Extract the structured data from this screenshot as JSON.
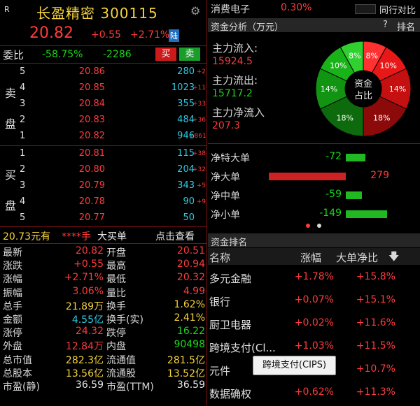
{
  "header": {
    "tag": "R",
    "stock_name": "长盈精密",
    "stock_code": "300115",
    "price": "20.82",
    "change": "+0.55",
    "change_pct": "+2.71%",
    "board_badge": "陆"
  },
  "committee": {
    "label": "委比",
    "ratio": "-58.75%",
    "diff": "-2286",
    "buy_label": "买",
    "sell_label": "卖"
  },
  "order_book": {
    "sell_side_label": "卖盘",
    "buy_side_label": "买盘",
    "sell": [
      {
        "level": "5",
        "price": "20.86",
        "volume": "280",
        "delta": "+2"
      },
      {
        "level": "4",
        "price": "20.85",
        "volume": "1023",
        "delta": "+11"
      },
      {
        "level": "3",
        "price": "20.84",
        "volume": "355",
        "delta": "+33"
      },
      {
        "level": "2",
        "price": "20.83",
        "volume": "484",
        "delta": "+36"
      },
      {
        "level": "1",
        "price": "20.82",
        "volume": "946",
        "delta": "+861"
      }
    ],
    "buy": [
      {
        "level": "1",
        "price": "20.81",
        "volume": "115",
        "delta": "+38"
      },
      {
        "level": "2",
        "price": "20.80",
        "volume": "204",
        "delta": "+32"
      },
      {
        "level": "3",
        "price": "20.79",
        "volume": "343",
        "delta": "+5"
      },
      {
        "level": "4",
        "price": "20.78",
        "volume": "90",
        "delta": "+9"
      },
      {
        "level": "5",
        "price": "20.77",
        "volume": "50",
        "delta": ""
      }
    ]
  },
  "big_order_bar": {
    "price_text": "20.73元有",
    "qty_text": "****手",
    "label": "大买单",
    "link": "点击查看"
  },
  "stats": [
    {
      "l1": "最新",
      "v1": "20.82",
      "c1": "red",
      "l2": "开盘",
      "v2": "20.51",
      "c2": "red"
    },
    {
      "l1": "涨跌",
      "v1": "+0.55",
      "c1": "red",
      "l2": "最高",
      "v2": "20.94",
      "c2": "red"
    },
    {
      "l1": "涨幅",
      "v1": "+2.71%",
      "c1": "red",
      "l2": "最低",
      "v2": "20.32",
      "c2": "red"
    },
    {
      "l1": "振幅",
      "v1": "3.06%",
      "c1": "red",
      "l2": "量比",
      "v2": "4.99",
      "c2": "red"
    },
    {
      "l1": "总手",
      "v1": "21.89万",
      "c1": "yellow",
      "l2": "换手",
      "v2": "1.62%",
      "c2": "yellow"
    },
    {
      "l1": "金额",
      "v1": "4.55亿",
      "c1": "cyan",
      "l2": "换手(实)",
      "v2": "2.41%",
      "c2": "yellow"
    },
    {
      "l1": "涨停",
      "v1": "24.32",
      "c1": "red",
      "l2": "跌停",
      "v2": "16.22",
      "c2": "green"
    },
    {
      "l1": "外盘",
      "v1": "12.84万",
      "c1": "red",
      "l2": "内盘",
      "v2": "90498",
      "c2": "green"
    },
    {
      "l1": "总市值",
      "v1": "282.3亿",
      "c1": "yellow",
      "l2": "流通值",
      "v2": "281.5亿",
      "c2": "yellow"
    },
    {
      "l1": "总股本",
      "v1": "13.56亿",
      "c1": "yellow",
      "l2": "流通股",
      "v2": "13.52亿",
      "c2": "yellow"
    },
    {
      "l1": "市盈(静)",
      "v1": "36.59",
      "c1": "white",
      "l2": "市盈(TTM)",
      "v2": "36.59",
      "c2": "white"
    }
  ],
  "sector_top": {
    "name": "消费电子",
    "pct": "0.30%",
    "compare": "同行对比"
  },
  "fund_analysis": {
    "title": "资金分析（万元）",
    "help": "?",
    "rank_link": "排名",
    "inflow_label": "主力流入:",
    "inflow_value": "15924.5",
    "outflow_label": "主力流出:",
    "outflow_value": "15717.2",
    "net_label": "主力净流入",
    "net_value": "207.3",
    "donut_center_1": "资金",
    "donut_center_2": "占比",
    "donut": [
      {
        "label": "8%",
        "value": 8,
        "color": "#ff3131"
      },
      {
        "label": "10%",
        "value": 10,
        "color": "#e81818"
      },
      {
        "label": "14%",
        "value": 14,
        "color": "#c41010"
      },
      {
        "label": "18%",
        "value": 18,
        "color": "#8c0a0a"
      },
      {
        "label": "18%",
        "value": 18,
        "color": "#0d6b0d"
      },
      {
        "label": "14%",
        "value": 14,
        "color": "#119411"
      },
      {
        "label": "10%",
        "value": 10,
        "color": "#19b319"
      },
      {
        "label": "8%",
        "value": 8,
        "color": "#2fd02f"
      }
    ]
  },
  "net_bars": [
    {
      "label": "净特大单",
      "value": -72
    },
    {
      "label": "净大单",
      "value": 279
    },
    {
      "label": "净中单",
      "value": -59
    },
    {
      "label": "净小单",
      "value": -149
    }
  ],
  "fund_rank": {
    "title": "资金排名",
    "col_name": "名称",
    "col_pct": "涨幅",
    "col_ratio": "大单净比",
    "rows": [
      {
        "name": "多元金融",
        "pct": "+1.78%",
        "ratio": "+15.8%"
      },
      {
        "name": "银行",
        "pct": "+0.07%",
        "ratio": "+15.1%"
      },
      {
        "name": "厨卫电器",
        "pct": "+0.02%",
        "ratio": "+11.6%"
      },
      {
        "name": "跨境支付(Cl...",
        "pct": "+1.03%",
        "ratio": "+11.5%"
      },
      {
        "name": "元件",
        "pct": "",
        "ratio": "+10.7%"
      },
      {
        "name": "数据确权",
        "pct": "+0.62%",
        "ratio": "+11.3%"
      }
    ],
    "tooltip": "跨境支付(CIPS)"
  }
}
